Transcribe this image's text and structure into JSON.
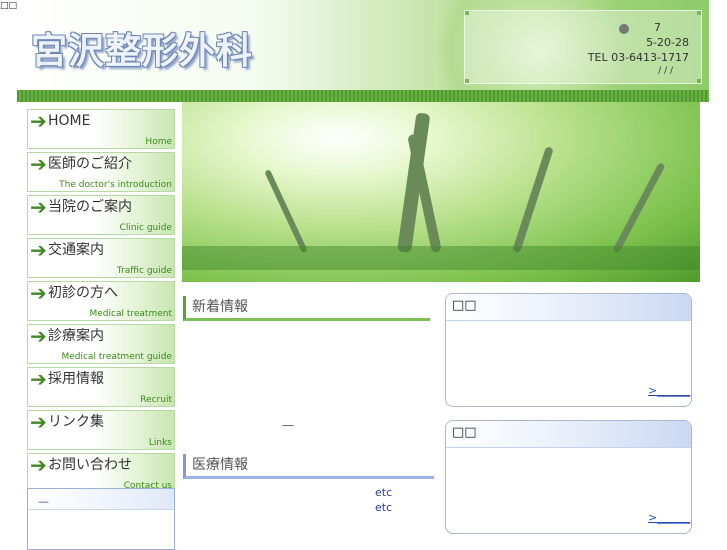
{
  "top_text": "□□□□/□□□□/□□□□/□□□□□/□□□□□□□□□□□□□□",
  "header": {
    "logo": "宮沢整形外科",
    "info": {
      "line1": "7",
      "line2": "5-20-28",
      "line3": "TEL 03-6413-1717",
      "line4": "/ / /"
    }
  },
  "nav": [
    {
      "jp": "HOME",
      "en": "Home"
    },
    {
      "jp": "医師のご紹介",
      "en": "The doctor's introduction"
    },
    {
      "jp": "当院のご案内",
      "en": "Clinic guide"
    },
    {
      "jp": "交通案内",
      "en": "Traffic guide"
    },
    {
      "jp": "初診の方へ",
      "en": "Medical treatment"
    },
    {
      "jp": "診療案内",
      "en": "Medical treatment guide"
    },
    {
      "jp": "採用情報",
      "en": "Recruit"
    },
    {
      "jp": "リンク集",
      "en": "Links"
    },
    {
      "jp": "お問い合わせ",
      "en": "Contact us"
    }
  ],
  "sidebar_box": {
    "link": "—"
  },
  "news": {
    "title": "新着情報",
    "dash": "—"
  },
  "medical": {
    "title": "医療情報",
    "etc1": "etc",
    "etc2": "etc"
  },
  "box1": {
    "title": "□□",
    "more": ">______"
  },
  "box2": {
    "title": "□□",
    "more": ">______"
  },
  "colors": {
    "accent_green": "#3f8a24",
    "link_blue": "#2a4fb0"
  }
}
